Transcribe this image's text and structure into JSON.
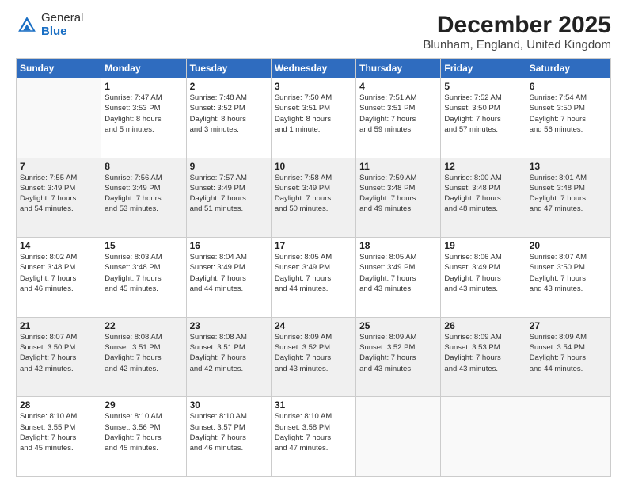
{
  "logo": {
    "general": "General",
    "blue": "Blue"
  },
  "title": "December 2025",
  "location": "Blunham, England, United Kingdom",
  "days_of_week": [
    "Sunday",
    "Monday",
    "Tuesday",
    "Wednesday",
    "Thursday",
    "Friday",
    "Saturday"
  ],
  "weeks": [
    [
      {
        "day": "",
        "info": ""
      },
      {
        "day": "1",
        "info": "Sunrise: 7:47 AM\nSunset: 3:53 PM\nDaylight: 8 hours\nand 5 minutes."
      },
      {
        "day": "2",
        "info": "Sunrise: 7:48 AM\nSunset: 3:52 PM\nDaylight: 8 hours\nand 3 minutes."
      },
      {
        "day": "3",
        "info": "Sunrise: 7:50 AM\nSunset: 3:51 PM\nDaylight: 8 hours\nand 1 minute."
      },
      {
        "day": "4",
        "info": "Sunrise: 7:51 AM\nSunset: 3:51 PM\nDaylight: 7 hours\nand 59 minutes."
      },
      {
        "day": "5",
        "info": "Sunrise: 7:52 AM\nSunset: 3:50 PM\nDaylight: 7 hours\nand 57 minutes."
      },
      {
        "day": "6",
        "info": "Sunrise: 7:54 AM\nSunset: 3:50 PM\nDaylight: 7 hours\nand 56 minutes."
      }
    ],
    [
      {
        "day": "7",
        "info": "Sunrise: 7:55 AM\nSunset: 3:49 PM\nDaylight: 7 hours\nand 54 minutes."
      },
      {
        "day": "8",
        "info": "Sunrise: 7:56 AM\nSunset: 3:49 PM\nDaylight: 7 hours\nand 53 minutes."
      },
      {
        "day": "9",
        "info": "Sunrise: 7:57 AM\nSunset: 3:49 PM\nDaylight: 7 hours\nand 51 minutes."
      },
      {
        "day": "10",
        "info": "Sunrise: 7:58 AM\nSunset: 3:49 PM\nDaylight: 7 hours\nand 50 minutes."
      },
      {
        "day": "11",
        "info": "Sunrise: 7:59 AM\nSunset: 3:48 PM\nDaylight: 7 hours\nand 49 minutes."
      },
      {
        "day": "12",
        "info": "Sunrise: 8:00 AM\nSunset: 3:48 PM\nDaylight: 7 hours\nand 48 minutes."
      },
      {
        "day": "13",
        "info": "Sunrise: 8:01 AM\nSunset: 3:48 PM\nDaylight: 7 hours\nand 47 minutes."
      }
    ],
    [
      {
        "day": "14",
        "info": "Sunrise: 8:02 AM\nSunset: 3:48 PM\nDaylight: 7 hours\nand 46 minutes."
      },
      {
        "day": "15",
        "info": "Sunrise: 8:03 AM\nSunset: 3:48 PM\nDaylight: 7 hours\nand 45 minutes."
      },
      {
        "day": "16",
        "info": "Sunrise: 8:04 AM\nSunset: 3:49 PM\nDaylight: 7 hours\nand 44 minutes."
      },
      {
        "day": "17",
        "info": "Sunrise: 8:05 AM\nSunset: 3:49 PM\nDaylight: 7 hours\nand 44 minutes."
      },
      {
        "day": "18",
        "info": "Sunrise: 8:05 AM\nSunset: 3:49 PM\nDaylight: 7 hours\nand 43 minutes."
      },
      {
        "day": "19",
        "info": "Sunrise: 8:06 AM\nSunset: 3:49 PM\nDaylight: 7 hours\nand 43 minutes."
      },
      {
        "day": "20",
        "info": "Sunrise: 8:07 AM\nSunset: 3:50 PM\nDaylight: 7 hours\nand 43 minutes."
      }
    ],
    [
      {
        "day": "21",
        "info": "Sunrise: 8:07 AM\nSunset: 3:50 PM\nDaylight: 7 hours\nand 42 minutes."
      },
      {
        "day": "22",
        "info": "Sunrise: 8:08 AM\nSunset: 3:51 PM\nDaylight: 7 hours\nand 42 minutes."
      },
      {
        "day": "23",
        "info": "Sunrise: 8:08 AM\nSunset: 3:51 PM\nDaylight: 7 hours\nand 42 minutes."
      },
      {
        "day": "24",
        "info": "Sunrise: 8:09 AM\nSunset: 3:52 PM\nDaylight: 7 hours\nand 43 minutes."
      },
      {
        "day": "25",
        "info": "Sunrise: 8:09 AM\nSunset: 3:52 PM\nDaylight: 7 hours\nand 43 minutes."
      },
      {
        "day": "26",
        "info": "Sunrise: 8:09 AM\nSunset: 3:53 PM\nDaylight: 7 hours\nand 43 minutes."
      },
      {
        "day": "27",
        "info": "Sunrise: 8:09 AM\nSunset: 3:54 PM\nDaylight: 7 hours\nand 44 minutes."
      }
    ],
    [
      {
        "day": "28",
        "info": "Sunrise: 8:10 AM\nSunset: 3:55 PM\nDaylight: 7 hours\nand 45 minutes."
      },
      {
        "day": "29",
        "info": "Sunrise: 8:10 AM\nSunset: 3:56 PM\nDaylight: 7 hours\nand 45 minutes."
      },
      {
        "day": "30",
        "info": "Sunrise: 8:10 AM\nSunset: 3:57 PM\nDaylight: 7 hours\nand 46 minutes."
      },
      {
        "day": "31",
        "info": "Sunrise: 8:10 AM\nSunset: 3:58 PM\nDaylight: 7 hours\nand 47 minutes."
      },
      {
        "day": "",
        "info": ""
      },
      {
        "day": "",
        "info": ""
      },
      {
        "day": "",
        "info": ""
      }
    ]
  ]
}
